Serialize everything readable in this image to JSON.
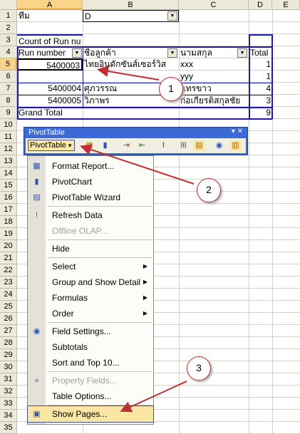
{
  "columns": [
    "A",
    "B",
    "C",
    "D",
    "E"
  ],
  "rows": [
    "1",
    "2",
    "3",
    "4",
    "5",
    "6",
    "7",
    "8",
    "9",
    "10",
    "11",
    "12",
    "13",
    "14",
    "15",
    "16",
    "17",
    "18",
    "19",
    "20",
    "21",
    "22",
    "23",
    "24",
    "25",
    "26",
    "27",
    "28",
    "29",
    "30",
    "31",
    "32",
    "33",
    "34",
    "35"
  ],
  "sheet": {
    "r1": {
      "a": "ทีม",
      "b": "D"
    },
    "r3": {
      "a": "Count of Run nu"
    },
    "r4": {
      "a": "Run number",
      "b": "ชื่อลูกค้า",
      "c": "นามสกุล",
      "d": "Total"
    },
    "r5": {
      "a": "5400003",
      "b": "ไทยอินดักซันส์เซอร์วิส",
      "c": "xxx",
      "d": "1"
    },
    "r6": {
      "c": "yyy",
      "d": "1"
    },
    "r7": {
      "a": "5400004",
      "b": "ศุภวรรณ",
      "c": "แทรขาว",
      "d": "4"
    },
    "r8": {
      "a": "5400005",
      "b": "วิภาพร",
      "c": "ก่อเกียรติสกุลชัย",
      "d": "3"
    },
    "r9": {
      "a": "Grand Total",
      "d": "9"
    }
  },
  "toolbar": {
    "title": "PivotTable",
    "pivot_button": "PivotTable",
    "pivot_arrow": "▾",
    "controls": "▾ ✕"
  },
  "menu": [
    {
      "label": "Format Report...",
      "icon": "format-report-icon",
      "glyph": "▦",
      "disabled": false
    },
    {
      "label": "PivotChart",
      "icon": "pivotchart-icon",
      "glyph": "▮",
      "disabled": false
    },
    {
      "label": "PivotTable Wizard",
      "icon": "wizard-icon",
      "glyph": "▤",
      "disabled": false
    },
    {
      "label": "Refresh Data",
      "icon": "refresh-icon",
      "glyph": "!",
      "disabled": false
    },
    {
      "label": "Offline OLAP...",
      "icon": "",
      "glyph": "",
      "disabled": true
    },
    {
      "label": "Hide",
      "icon": "",
      "glyph": "",
      "disabled": false
    },
    {
      "label": "Select",
      "icon": "",
      "glyph": "",
      "disabled": false,
      "submenu": true
    },
    {
      "label": "Group and Show Detail",
      "icon": "",
      "glyph": "",
      "disabled": false,
      "submenu": true
    },
    {
      "label": "Formulas",
      "icon": "",
      "glyph": "",
      "disabled": false,
      "submenu": true
    },
    {
      "label": "Order",
      "icon": "",
      "glyph": "",
      "disabled": false,
      "submenu": true
    },
    {
      "label": "Field Settings...",
      "icon": "field-settings-icon",
      "glyph": "◉",
      "disabled": false
    },
    {
      "label": "Subtotals",
      "icon": "",
      "glyph": "",
      "disabled": false
    },
    {
      "label": "Sort and Top 10...",
      "icon": "",
      "glyph": "",
      "disabled": false
    },
    {
      "label": "Property Fields...",
      "icon": "property-fields-icon",
      "glyph": "●",
      "disabled": true
    },
    {
      "label": "Table Options...",
      "icon": "",
      "glyph": "",
      "disabled": false
    },
    {
      "label": "Show Pages...",
      "icon": "show-pages-icon",
      "glyph": "▣",
      "disabled": false,
      "highlighted": true
    }
  ],
  "submenu_arrow": "▶",
  "annotations": [
    "1",
    "2",
    "3"
  ],
  "colors": {
    "accent": "#c03030",
    "toolbar": "#3a6ad8",
    "highlight": "#fbe7a4"
  }
}
